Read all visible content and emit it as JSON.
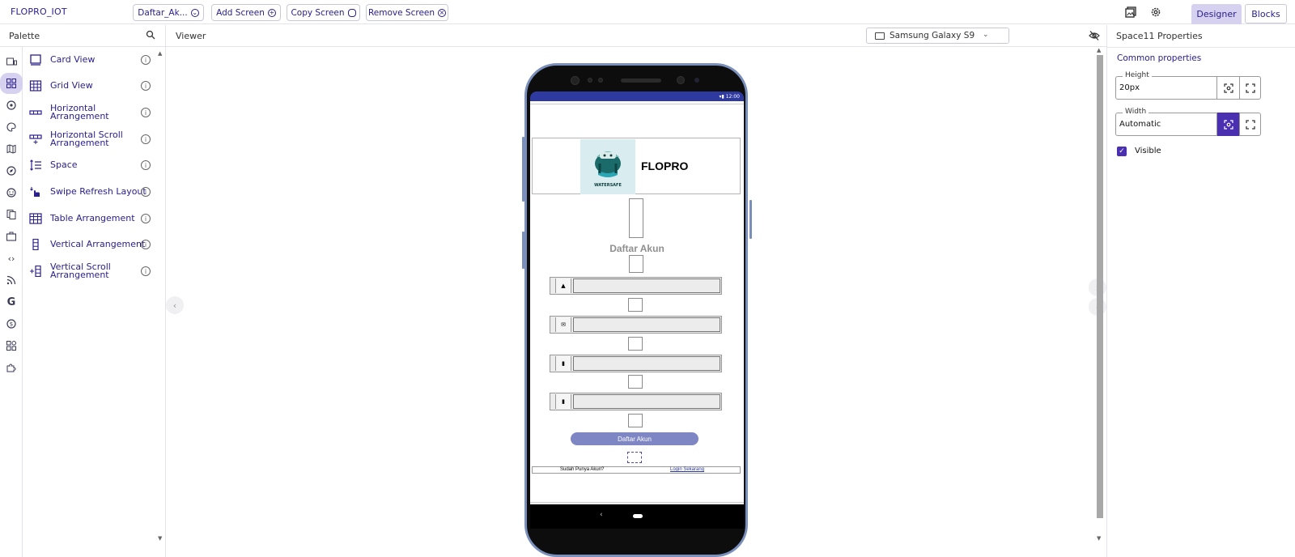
{
  "app": {
    "title": "FLOPRO_IOT"
  },
  "toolbar": {
    "screen_select": "Daftar_Ak...",
    "add_screen": "Add Screen",
    "copy_screen": "Copy Screen",
    "remove_screen": "Remove Screen",
    "designer": "Designer",
    "blocks": "Blocks"
  },
  "palette": {
    "title": "Palette",
    "items": [
      {
        "label": "Card View",
        "icon": "card-view-icon"
      },
      {
        "label": "Grid View",
        "icon": "grid-view-icon"
      },
      {
        "label": "Horizontal Arrangement",
        "icon": "horizontal-arrangement-icon"
      },
      {
        "label": "Horizontal Scroll Arrangement",
        "icon": "horizontal-scroll-arrangement-icon"
      },
      {
        "label": "Space",
        "icon": "space-icon"
      },
      {
        "label": "Swipe Refresh Layout",
        "icon": "swipe-refresh-icon"
      },
      {
        "label": "Table Arrangement",
        "icon": "table-arrangement-icon"
      },
      {
        "label": "Vertical Arrangement",
        "icon": "vertical-arrangement-icon"
      },
      {
        "label": "Vertical Scroll Arrangement",
        "icon": "vertical-scroll-arrangement-icon"
      }
    ]
  },
  "viewer": {
    "title": "Viewer",
    "device": "Samsung Galaxy S9"
  },
  "phone": {
    "status_time": "12:00",
    "brand": "FLOPRO",
    "logo_text": "WATERSAFE",
    "title": "Daftar Akun",
    "button": "Daftar Akun",
    "footer_question": "Sudah Punya Akun?",
    "footer_link": "Login Sekarang"
  },
  "properties": {
    "title": "Space11 Properties",
    "section": "Common properties",
    "height_label": "Height",
    "height_value": "20px",
    "width_label": "Width",
    "width_value": "Automatic",
    "visible_label": "Visible"
  },
  "colors": {
    "accent": "#2a2090",
    "selected": "#4a2fb0",
    "statusbar": "#2f3aa0"
  }
}
